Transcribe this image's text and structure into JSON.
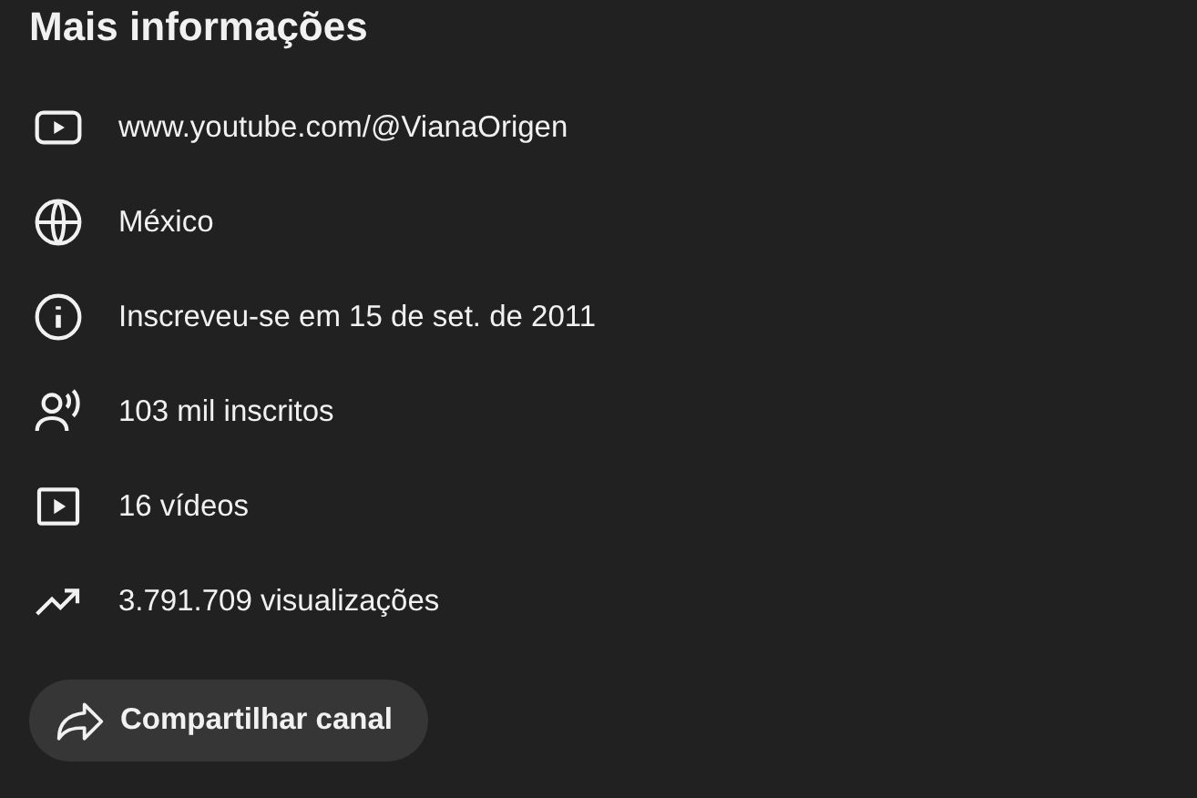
{
  "section_title": "Mais informações",
  "details": [
    {
      "kind": "channel",
      "text": "www.youtube.com/@VianaOrigen"
    },
    {
      "kind": "country",
      "text": "México"
    },
    {
      "kind": "joined",
      "text": "Inscreveu-se em 15 de set. de 2011"
    },
    {
      "kind": "subscribers",
      "text": "103 mil inscritos"
    },
    {
      "kind": "videos",
      "text": "16 vídeos"
    },
    {
      "kind": "views",
      "text": "3.791.709 visualizações"
    }
  ],
  "share_button": {
    "label": "Compartilhar canal"
  }
}
